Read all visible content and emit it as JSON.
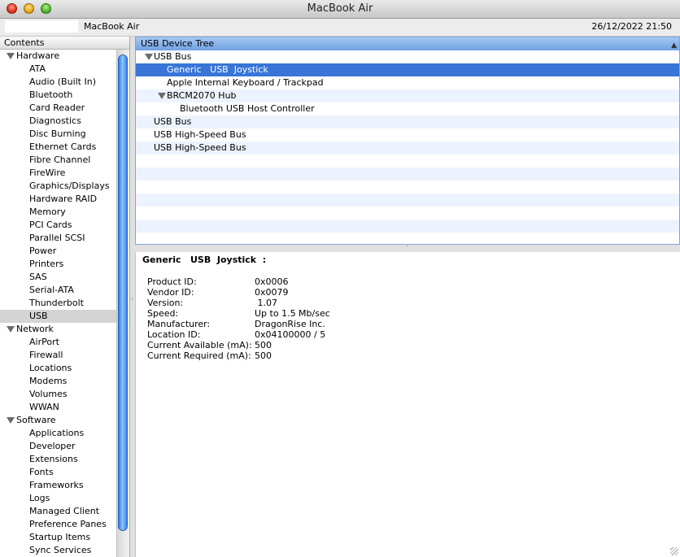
{
  "window": {
    "title": "MacBook Air"
  },
  "infobar": {
    "machine_name": "MacBook Air",
    "date": "26/12/2022 21:50"
  },
  "sidebar": {
    "header": "Contents",
    "rows": [
      {
        "label": "Hardware",
        "type": "cat"
      },
      {
        "label": "ATA",
        "type": "item"
      },
      {
        "label": "Audio (Built In)",
        "type": "item"
      },
      {
        "label": "Bluetooth",
        "type": "item"
      },
      {
        "label": "Card Reader",
        "type": "item"
      },
      {
        "label": "Diagnostics",
        "type": "item"
      },
      {
        "label": "Disc Burning",
        "type": "item"
      },
      {
        "label": "Ethernet Cards",
        "type": "item"
      },
      {
        "label": "Fibre Channel",
        "type": "item"
      },
      {
        "label": "FireWire",
        "type": "item"
      },
      {
        "label": "Graphics/Displays",
        "type": "item"
      },
      {
        "label": "Hardware RAID",
        "type": "item"
      },
      {
        "label": "Memory",
        "type": "item"
      },
      {
        "label": "PCI Cards",
        "type": "item"
      },
      {
        "label": "Parallel SCSI",
        "type": "item"
      },
      {
        "label": "Power",
        "type": "item"
      },
      {
        "label": "Printers",
        "type": "item"
      },
      {
        "label": "SAS",
        "type": "item"
      },
      {
        "label": "Serial-ATA",
        "type": "item"
      },
      {
        "label": "Thunderbolt",
        "type": "item"
      },
      {
        "label": "USB",
        "type": "item",
        "selected": true
      },
      {
        "label": "Network",
        "type": "cat"
      },
      {
        "label": "AirPort",
        "type": "item"
      },
      {
        "label": "Firewall",
        "type": "item"
      },
      {
        "label": "Locations",
        "type": "item"
      },
      {
        "label": "Modems",
        "type": "item"
      },
      {
        "label": "Volumes",
        "type": "item"
      },
      {
        "label": "WWAN",
        "type": "item"
      },
      {
        "label": "Software",
        "type": "cat"
      },
      {
        "label": "Applications",
        "type": "item"
      },
      {
        "label": "Developer",
        "type": "item"
      },
      {
        "label": "Extensions",
        "type": "item"
      },
      {
        "label": "Fonts",
        "type": "item"
      },
      {
        "label": "Frameworks",
        "type": "item"
      },
      {
        "label": "Logs",
        "type": "item"
      },
      {
        "label": "Managed Client",
        "type": "item"
      },
      {
        "label": "Preference Panes",
        "type": "item"
      },
      {
        "label": "Startup Items",
        "type": "item"
      },
      {
        "label": "Sync Services",
        "type": "item"
      }
    ]
  },
  "tree": {
    "header": "USB Device Tree",
    "rows": [
      {
        "label": "USB Bus",
        "level": 0,
        "expanded": true
      },
      {
        "label": "Generic   USB  Joystick",
        "level": 1,
        "selected": true
      },
      {
        "label": "Apple Internal Keyboard / Trackpad",
        "level": 1
      },
      {
        "label": "BRCM2070 Hub",
        "level": 1,
        "expanded": true
      },
      {
        "label": "Bluetooth USB Host Controller",
        "level": 2
      },
      {
        "label": "USB Bus",
        "level": 0
      },
      {
        "label": "USB High-Speed Bus",
        "level": 0
      },
      {
        "label": "USB High-Speed Bus",
        "level": 0
      },
      {
        "label": "",
        "level": 0
      },
      {
        "label": "",
        "level": 0
      },
      {
        "label": "",
        "level": 0
      },
      {
        "label": "",
        "level": 0
      },
      {
        "label": "",
        "level": 0
      },
      {
        "label": "",
        "level": 0
      },
      {
        "label": "",
        "level": 0
      }
    ]
  },
  "detail": {
    "title": "Generic   USB  Joystick  :",
    "props": [
      {
        "key": "Product ID:",
        "value": "0x0006"
      },
      {
        "key": "Vendor ID:",
        "value": "0x0079"
      },
      {
        "key": "Version:",
        "value": " 1.07"
      },
      {
        "key": "Speed:",
        "value": "Up to 1.5 Mb/sec"
      },
      {
        "key": "Manufacturer:",
        "value": "DragonRise Inc."
      },
      {
        "key": "Location ID:",
        "value": "0x04100000 / 5"
      },
      {
        "key": "Current Available (mA):",
        "value": "500"
      },
      {
        "key": "Current Required (mA):",
        "value": "500"
      }
    ]
  }
}
